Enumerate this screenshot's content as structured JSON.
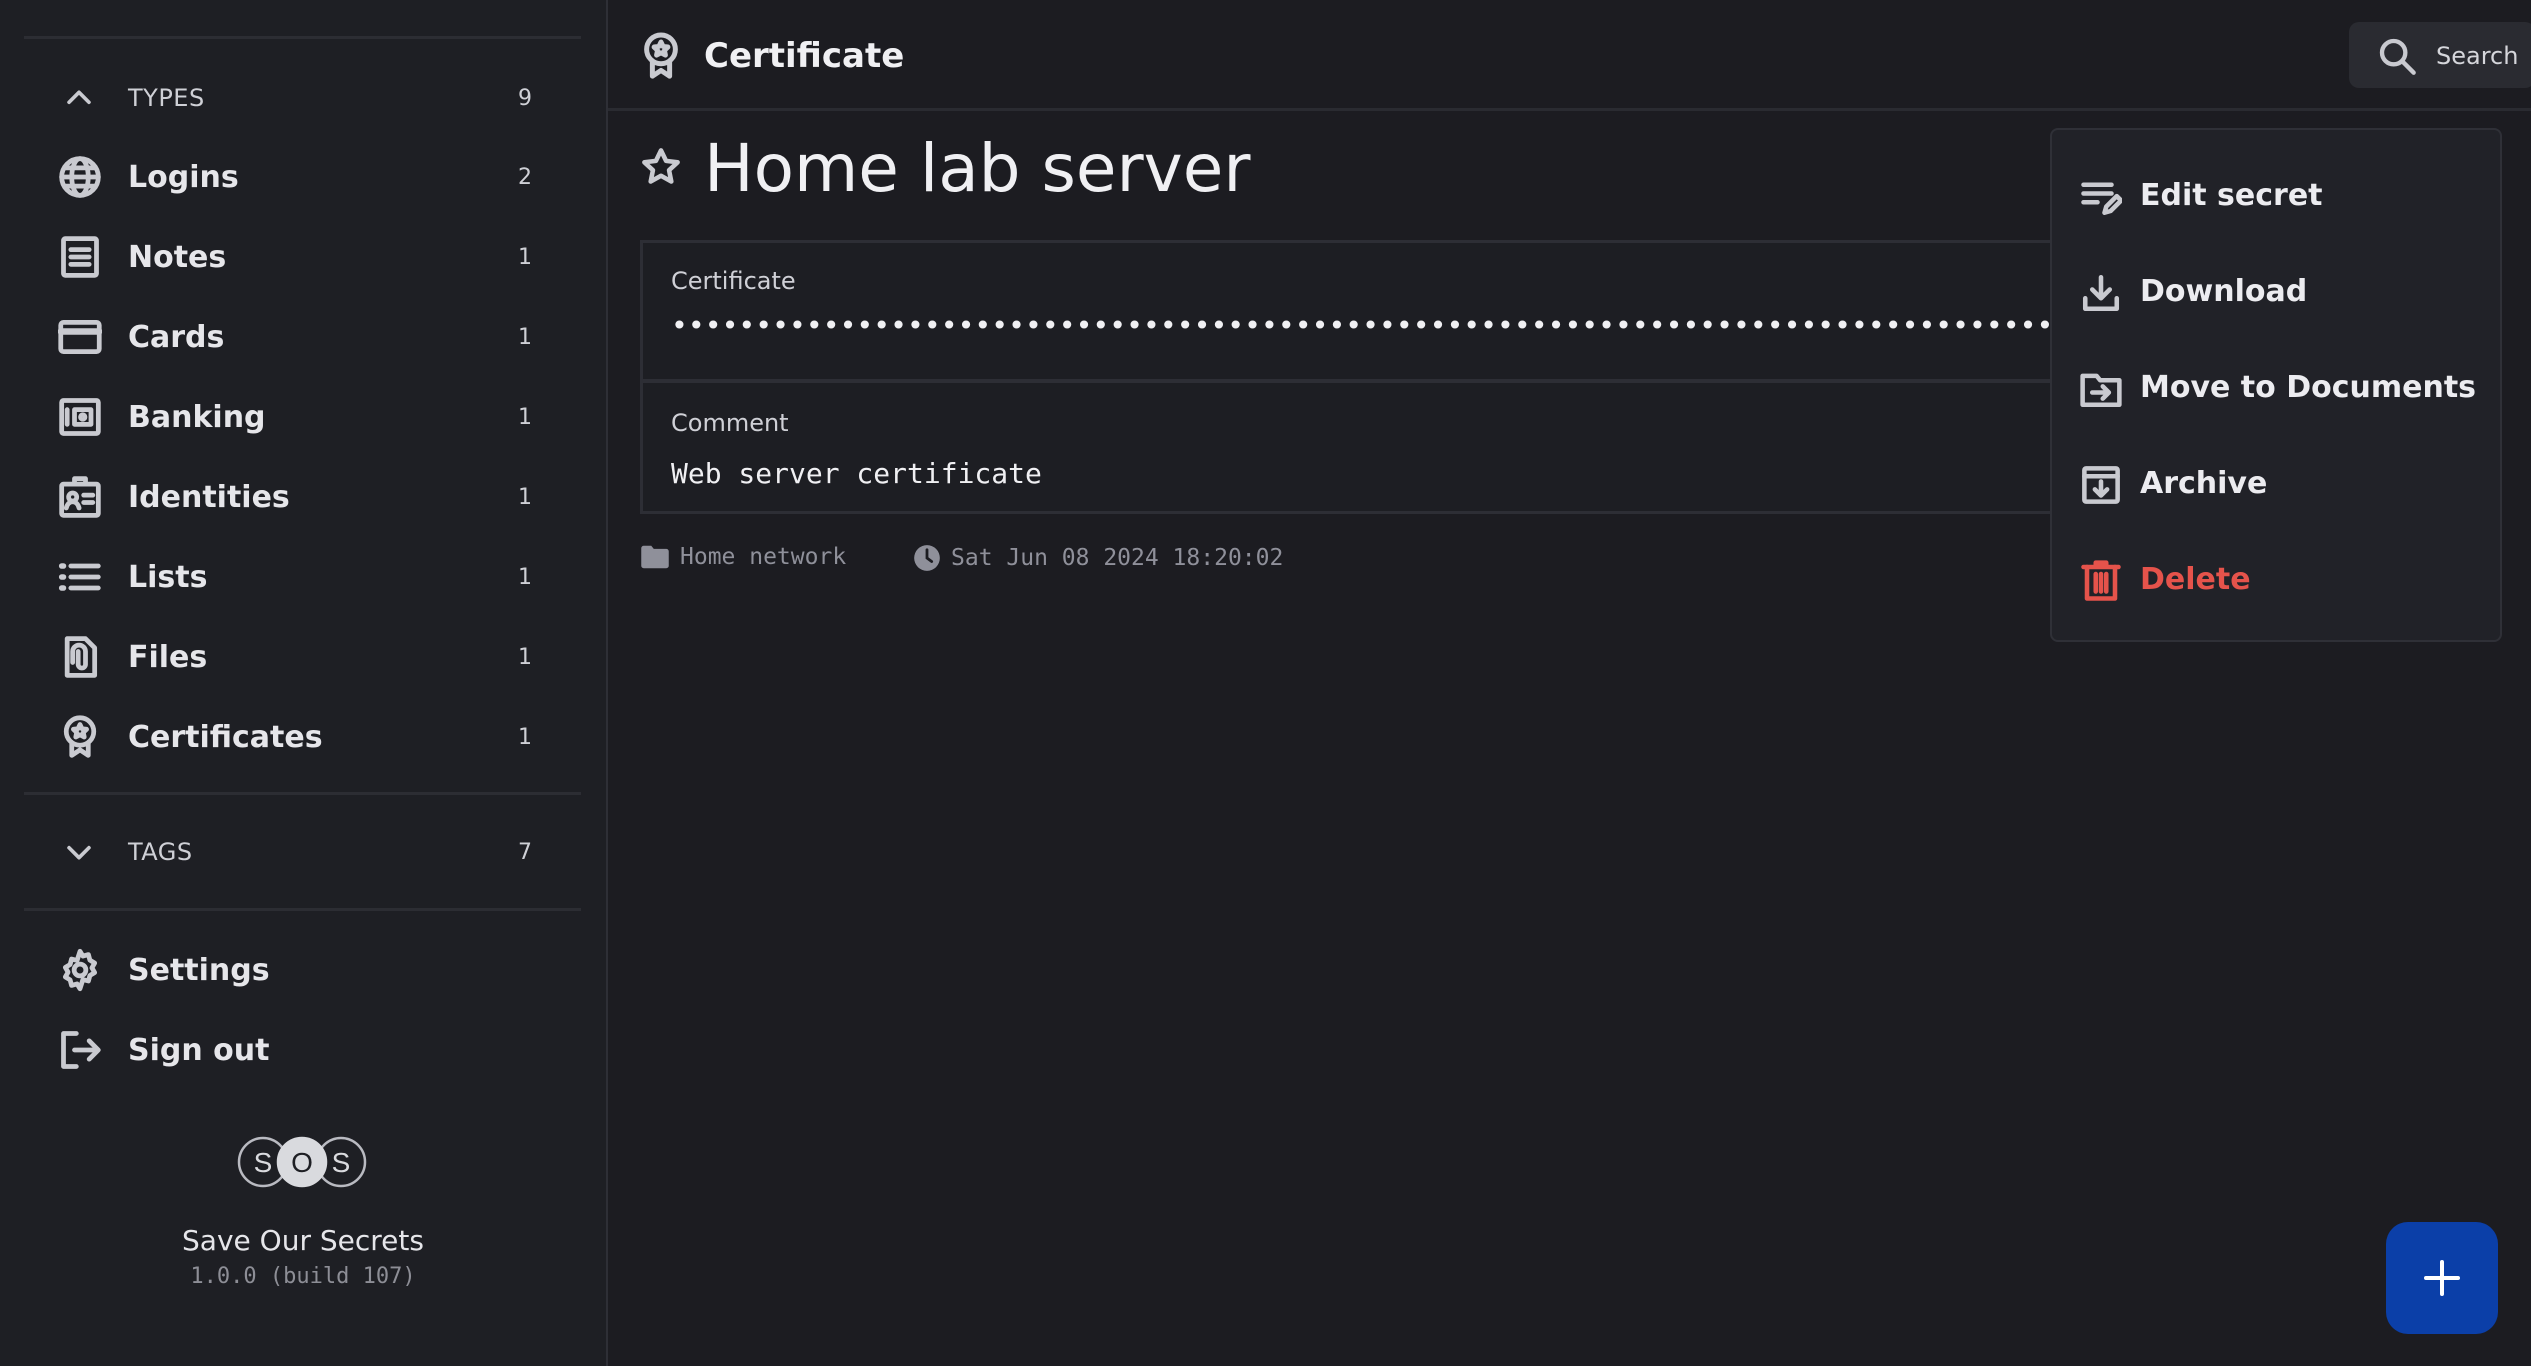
{
  "sidebar": {
    "types": {
      "label": "TYPES",
      "count": "9"
    },
    "items": [
      {
        "label": "Logins",
        "count": "2",
        "icon": "globe-icon"
      },
      {
        "label": "Notes",
        "count": "1",
        "icon": "note-icon"
      },
      {
        "label": "Cards",
        "count": "1",
        "icon": "card-icon"
      },
      {
        "label": "Banking",
        "count": "1",
        "icon": "bank-icon"
      },
      {
        "label": "Identities",
        "count": "1",
        "icon": "id-card-icon"
      },
      {
        "label": "Lists",
        "count": "1",
        "icon": "list-icon"
      },
      {
        "label": "Files",
        "count": "1",
        "icon": "file-clip-icon"
      },
      {
        "label": "Certificates",
        "count": "1",
        "icon": "certificate-icon"
      }
    ],
    "tags": {
      "label": "TAGS",
      "count": "7"
    },
    "settings": "Settings",
    "signout": "Sign out",
    "brand": {
      "logo_letters": "SOS",
      "name": "Save Our Secrets",
      "version": "1.0.0 (build 107)"
    }
  },
  "header": {
    "title": "Certificate",
    "search_label": "Search"
  },
  "secret": {
    "title": "Home lab server",
    "fields": [
      {
        "label": "Certificate",
        "value": "••••••••••••••••••••••••••••••••••••••••••••••••••••••••••••••••••••••••••••••••••••••••••••••••"
      },
      {
        "label": "Comment",
        "value": "Web server certificate"
      }
    ],
    "folder": "Home network",
    "timestamp": "Sat Jun 08 2024 18:20:02"
  },
  "menu": {
    "items": [
      {
        "label": "Edit secret",
        "icon": "edit-icon"
      },
      {
        "label": "Download",
        "icon": "download-icon"
      },
      {
        "label": "Move to Documents",
        "icon": "move-icon"
      },
      {
        "label": "Archive",
        "icon": "archive-icon"
      },
      {
        "label": "Delete",
        "icon": "trash-icon"
      }
    ]
  },
  "colors": {
    "background": "#1c1c21",
    "accent": "#0b3fa8",
    "danger": "#e5534b"
  }
}
